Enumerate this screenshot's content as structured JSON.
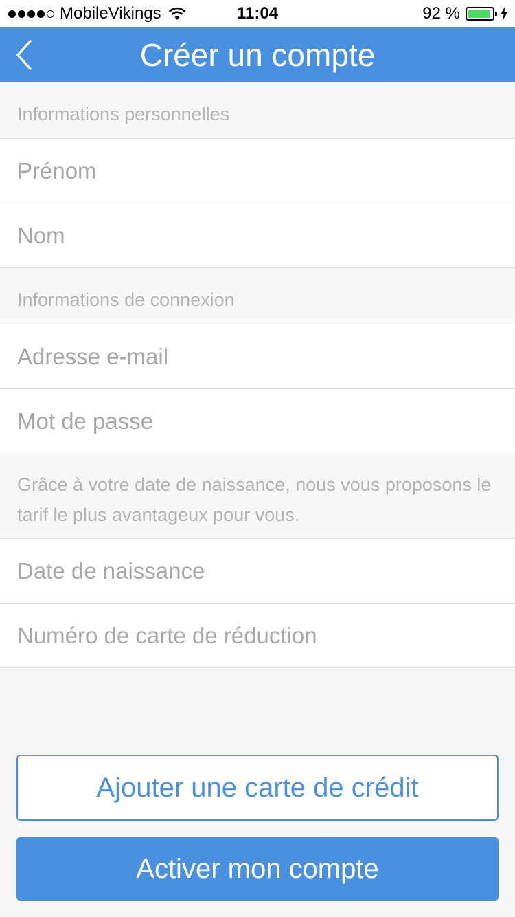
{
  "status_bar": {
    "carrier": "MobileVikings",
    "time": "11:04",
    "battery": "92 %",
    "battery_level": 0.92,
    "icons": [
      "signal-dots-icon",
      "wifi-icon",
      "battery-icon",
      "charging-bolt-icon"
    ]
  },
  "nav": {
    "back_icon": "chevron-left-icon",
    "title": "Créer un compte"
  },
  "sections": {
    "personal": "Informations personnelles",
    "login": "Informations de connexion",
    "birth_note": "Grâce à votre date de naissance, nous vous proposons le tarif le plus avantageux pour vous."
  },
  "fields": {
    "first_name": {
      "placeholder": "Prénom",
      "value": ""
    },
    "last_name": {
      "placeholder": "Nom",
      "value": ""
    },
    "email": {
      "placeholder": "Adresse e-mail",
      "value": ""
    },
    "password": {
      "placeholder": "Mot de passe",
      "value": ""
    },
    "birth_date": {
      "placeholder": "Date de naissance",
      "value": ""
    },
    "discount_card": {
      "placeholder": "Numéro de carte de réduction",
      "value": ""
    }
  },
  "buttons": {
    "add_credit_card": "Ajouter une carte de crédit",
    "activate_account": "Activer mon compte"
  },
  "colors": {
    "accent": "#4a90e0",
    "background": "#f7f7f7",
    "placeholder": "#a8a8a8",
    "section_text": "#b3b3b3",
    "battery_green": "#4cd964"
  }
}
